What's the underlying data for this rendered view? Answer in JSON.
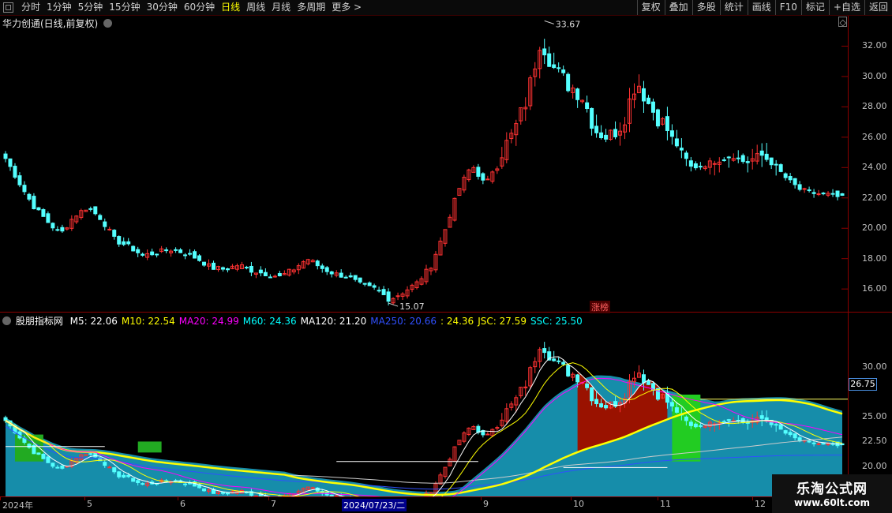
{
  "toolbar": {
    "periods": [
      "分时",
      "1分钟",
      "5分钟",
      "15分钟",
      "30分钟",
      "60分钟",
      "日线",
      "周线",
      "月线",
      "多周期",
      "更多 >"
    ],
    "active_period": "日线",
    "buttons": [
      "复权",
      "叠加",
      "多股",
      "统计",
      "画线",
      "F10",
      "标记",
      "+自选",
      "返回"
    ]
  },
  "stock": {
    "title": "华力创通(日线,前复权)"
  },
  "price_axis": [
    "32.00",
    "30.00",
    "28.00",
    "26.00",
    "24.00",
    "22.00",
    "20.00",
    "18.00",
    "16.00"
  ],
  "annotations": {
    "high": "33.67",
    "low": "15.07",
    "badge": "涨榜"
  },
  "indicator": {
    "name": "股朋指标网",
    "items": [
      {
        "label": "M5: 22.06",
        "color": "#ffffff"
      },
      {
        "label": "M10: 22.54",
        "color": "#ffff00"
      },
      {
        "label": "MA20: 24.99",
        "color": "#ff00ff"
      },
      {
        "label": "M60: 24.36",
        "color": "#00ffff"
      },
      {
        "label": "MA120: 21.20",
        "color": "#ffffff"
      },
      {
        "label": "MA250: 20.66",
        "color": "#3050ff"
      },
      {
        "label": ": 24.36",
        "color": "#ffff00"
      },
      {
        "label": "JSC: 27.59",
        "color": "#ffff00"
      },
      {
        "label": "SSC: 25.50",
        "color": "#00ffff"
      }
    ],
    "axis": [
      "30.00",
      "25.00",
      "22.50",
      "20.00"
    ],
    "current_tag": "26.75"
  },
  "xaxis": [
    {
      "label": "2024年",
      "date": false
    },
    {
      "label": "5",
      "date": false
    },
    {
      "label": "6",
      "date": false
    },
    {
      "label": "7",
      "date": false
    },
    {
      "label": "2024/07/23/二",
      "date": true
    },
    {
      "label": "9",
      "date": false
    },
    {
      "label": "10",
      "date": false
    },
    {
      "label": "11",
      "date": false
    },
    {
      "label": "12",
      "date": false
    }
  ],
  "watermark": {
    "title": "乐淘公式网",
    "url": "www.60lt.com"
  },
  "chart_data": {
    "type": "candlestick",
    "x": [
      "2024-04",
      "2024-05",
      "2024-06",
      "2024-07",
      "2024-08",
      "2024-09",
      "2024-10",
      "2024-11",
      "2024-12"
    ],
    "close_path": [
      24.6,
      23.0,
      21.5,
      20.5,
      19.6,
      20.8,
      21.4,
      20.6,
      19.2,
      18.8,
      18.2,
      18.4,
      18.6,
      18.4,
      18.0,
      17.4,
      17.3,
      17.6,
      17.2,
      17.0,
      16.8,
      17.3,
      18.0,
      17.4,
      17.0,
      16.8,
      16.2,
      16.0,
      15.3,
      15.8,
      16.4,
      17.5,
      19.8,
      22.5,
      24.2,
      22.8,
      24.8,
      26.2,
      28.5,
      32.5,
      30.5,
      29.5,
      28.8,
      26.5,
      26.0,
      27.0,
      29.8,
      28.0,
      26.8,
      25.4,
      24.0,
      24.2,
      24.5,
      24.8,
      24.3,
      24.9,
      24.2,
      23.2,
      22.5,
      22.3,
      22.2,
      22.0
    ],
    "price_ylim": [
      14.5,
      34.0
    ],
    "indicator_ylim": [
      17.0,
      34.0
    ]
  }
}
